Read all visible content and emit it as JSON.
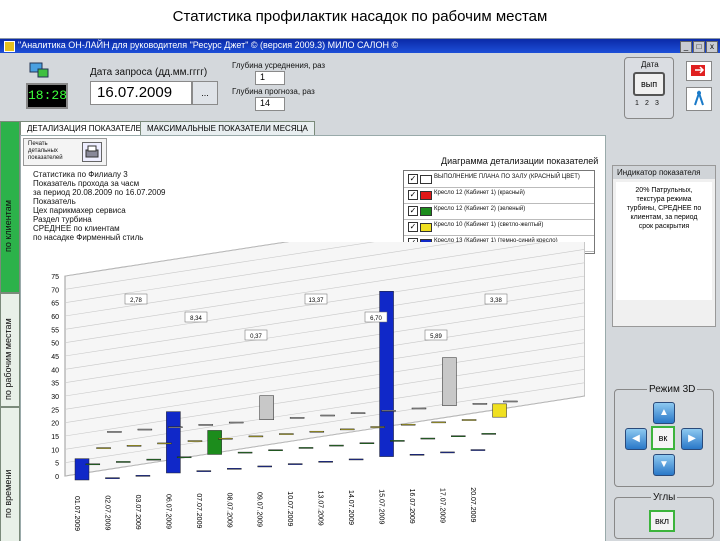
{
  "slide_title": "Статистика профилактик насадок по рабочим местам",
  "window": {
    "title": "\"Аналитика ОН-ЛАЙН для руководителя \"Ресурс Джет\" © (версия 2009.3)   МИЛО САЛОН ©",
    "btn_min": "_",
    "btn_max": "□",
    "btn_close": "x"
  },
  "header": {
    "clock": "18:28",
    "date_label": "Дата запроса (дд.мм.гггг)",
    "date_value": "16.07.2009",
    "date_btn": "...",
    "depth_label": "Глубина усреднения, раз",
    "depth_value": "1",
    "forecast_label": "Глубина прогноза, раз",
    "forecast_value": "14",
    "right_label": "Дата",
    "right_btn": "вып",
    "right_small_a": "1",
    "right_small_b": "2",
    "right_small_c": "3"
  },
  "side_tabs": {
    "tab1": "по клиентам",
    "tab2": "по рабочим местам",
    "tab3": "по времени"
  },
  "tabs": {
    "tab1": "ДЕТАЛИЗАЦИЯ ПОКАЗАТЕЛЕЙ",
    "tab2": "МАКСИМАЛЬНЫЕ ПОКАЗАТЕЛИ МЕСЯЦА"
  },
  "print": {
    "label": "Печать детальных показателей",
    "icon": "printer-icon"
  },
  "info_lines": [
    "Статистика по Филиалу 3",
    "Показатель прохода за часм",
    "за период 20.08.2009 по 16.07.2009",
    "Показатель",
    "Цех парикмахер сервиса",
    "Раздел турбина",
    "СРЕДНЕЕ по клиентам",
    "по насадке Фирменный стиль"
  ],
  "diagram_title": "Диаграмма детализации показателей",
  "legend": [
    {
      "check": "✓",
      "color": "#ffffff",
      "text": "ВЫПОЛНЕНИЕ ПЛАНА ПО ЗАЛУ (КРАСНЫЙ ЦВЕТ)"
    },
    {
      "check": "✓",
      "color": "#e01818",
      "text": "Кресло 12 (Кабинет 1) (красный)"
    },
    {
      "check": "✓",
      "color": "#1c8c1c",
      "text": "Кресло 12 (Кабинет 2) (зеленый)"
    },
    {
      "check": "✓",
      "color": "#f0e020",
      "text": "Кресло 10 (Кабинет 1) (светло-желтый)"
    },
    {
      "check": "✓",
      "color": "#1028c8",
      "text": "Кресло 13 (Кабинет 1) (темно-синий кресло)"
    }
  ],
  "indicator": {
    "title": "Индикатор показателя",
    "text": "20% Патрульных, текстура режима турбины, СРЕДНЕЕ по клиентам, за период срок раскрытия"
  },
  "mode": {
    "label": "Режим 3D",
    "up": "▲",
    "down": "▼",
    "left": "◀",
    "right": "▶",
    "center": "вк"
  },
  "views": {
    "label": "Углы",
    "btn": "вкл"
  },
  "colors": {
    "green": "#2a9a3a",
    "blue_bar": "#1028c8",
    "grey_bar": "#c8c8c8"
  },
  "chart_data": {
    "type": "bar",
    "y_ticks": [
      "0",
      "5",
      "10",
      "15",
      "20",
      "25",
      "30",
      "35",
      "40",
      "45",
      "50",
      "55",
      "60",
      "65",
      "70",
      "75"
    ],
    "ylim": [
      0,
      75
    ],
    "categories": [
      "01.07.2009",
      "02.07.2009",
      "03.07.2009",
      "06.07.2009",
      "07.07.2009",
      "08.07.2009",
      "09.07.2009",
      "10.07.2009",
      "13.07.2009",
      "14.07.2009",
      "15.07.2009",
      "16.07.2009",
      "17.07.2009",
      "20.07.2009"
    ],
    "series": [
      {
        "name": "Кресло 13 (Кабинет 1) (темно-синий кресло)",
        "color": "#1028c8",
        "values": [
          8,
          0,
          0,
          23,
          0,
          0,
          0,
          0,
          0,
          0,
          62,
          0,
          0,
          0
        ]
      },
      {
        "name": "Кресло 12 (Кабинет 2) (зеленый)",
        "color": "#1c8c1c",
        "values": [
          0,
          0,
          0,
          0,
          9,
          0,
          0,
          0,
          0,
          0,
          0,
          0,
          0,
          0
        ]
      },
      {
        "name": "Кресло 10 (Кабинет 1) (светло-желтый)",
        "color": "#f0e020",
        "values": [
          0,
          0,
          0,
          0,
          0,
          0,
          0,
          0,
          0,
          0,
          0,
          0,
          0,
          5
        ]
      },
      {
        "name": "ВЫПОЛНЕНИЕ ПЛАНА ПО ЗАЛУ (КРАСНЫЙ ЦВЕТ)",
        "color": "#c8c8c8",
        "values": [
          0,
          0,
          0,
          0,
          0,
          9,
          0,
          0,
          0,
          0,
          0,
          18,
          0,
          0
        ]
      }
    ],
    "data_labels": [
      "2,78",
      "8,34",
      "0,37",
      "13,37",
      "6,70",
      "5,89",
      "3,38"
    ],
    "grid": true,
    "legend_position": "top-right"
  }
}
